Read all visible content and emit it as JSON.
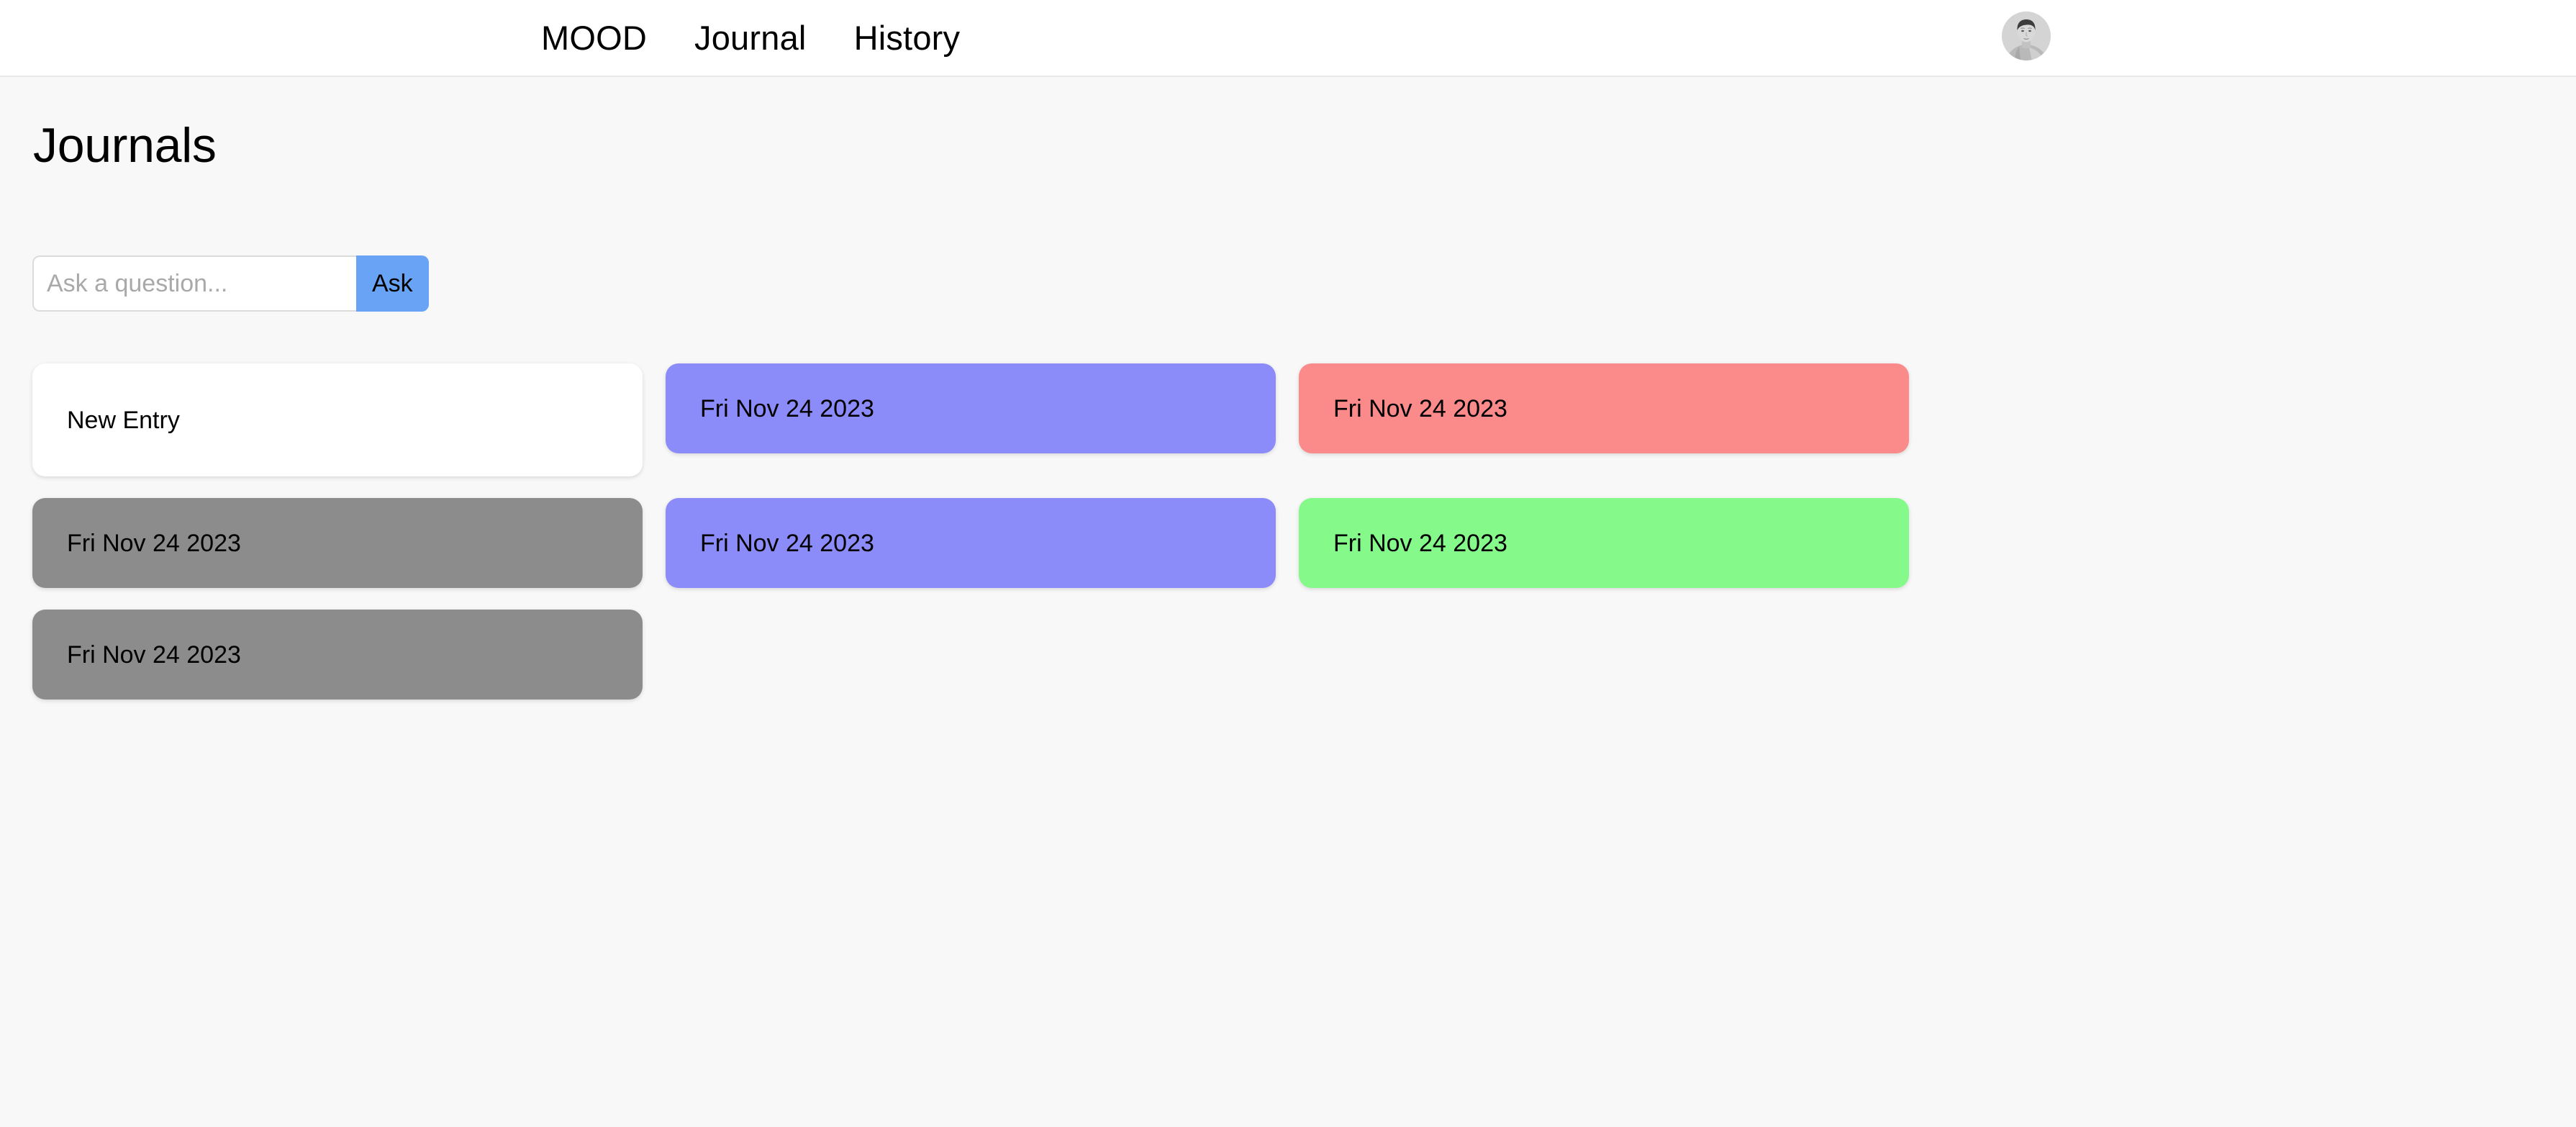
{
  "header": {
    "nav_items": [
      {
        "label": "MOOD",
        "name": "nav-link-mood"
      },
      {
        "label": "Journal",
        "name": "nav-link-journal"
      },
      {
        "label": "History",
        "name": "nav-link-history"
      }
    ],
    "avatar_alt": "user-avatar"
  },
  "page": {
    "title": "Journals"
  },
  "search": {
    "placeholder": "Ask a question...",
    "value": "",
    "button_label": "Ask"
  },
  "colors": {
    "page_background": "#f8f8f8",
    "header_background": "#ffffff",
    "header_border": "#e9e9e9",
    "ask_button": "#68a3f5",
    "card_purple": "#8b8bfa",
    "card_red": "#fb8a8a",
    "card_gray": "#8c8c8c",
    "card_green": "#85f98a",
    "card_white": "#ffffff",
    "text": "#000000",
    "placeholder_text": "#a9a9a9"
  },
  "cards": [
    {
      "label": "New Entry",
      "color": "#ffffff",
      "kind": "new-entry"
    },
    {
      "label": "Fri Nov 24 2023",
      "color": "#8b8bfa",
      "kind": "entry"
    },
    {
      "label": "Fri Nov 24 2023",
      "color": "#fb8a8a",
      "kind": "entry"
    },
    {
      "label": "Fri Nov 24 2023",
      "color": "#8c8c8c",
      "kind": "entry"
    },
    {
      "label": "Fri Nov 24 2023",
      "color": "#8b8bfa",
      "kind": "entry"
    },
    {
      "label": "Fri Nov 24 2023",
      "color": "#85f98a",
      "kind": "entry"
    },
    {
      "label": "Fri Nov 24 2023",
      "color": "#8c8c8c",
      "kind": "entry"
    }
  ]
}
